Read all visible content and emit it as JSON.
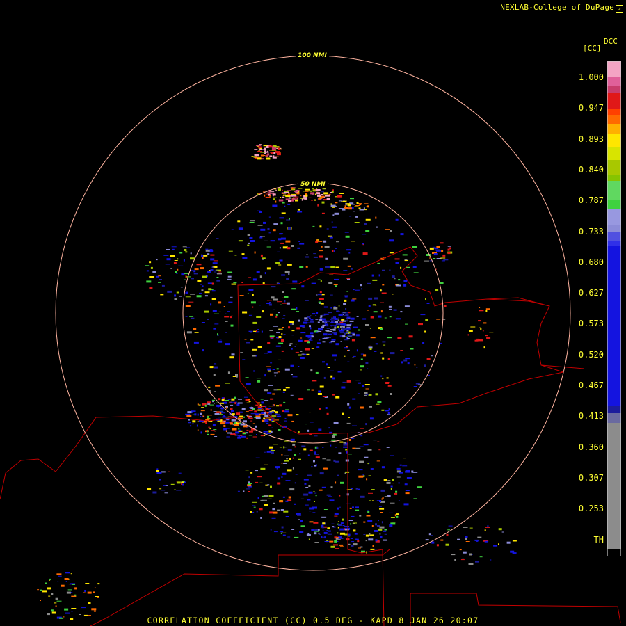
{
  "header": {
    "credit": "NEXLAB-College of DuPage",
    "credit_icon": "external-link-icon"
  },
  "footer": {
    "caption": "CORRELATION COEFFICIENT (CC) 0.5 DEG - KAPD 8 JAN 26 20:07"
  },
  "rings": [
    {
      "label": "100 NMI",
      "range_nmi": 100
    },
    {
      "label": "50 NMI",
      "range_nmi": 50
    }
  ],
  "legend": {
    "title": "DCC",
    "unit": "[CC]",
    "labels": [
      "1.000",
      "0.947",
      "0.893",
      "0.840",
      "0.787",
      "0.733",
      "0.680",
      "0.627",
      "0.573",
      "0.520",
      "0.467",
      "0.413",
      "0.360",
      "0.307",
      "0.253",
      "TH"
    ],
    "colors": {
      "pink": "#f4a4c4",
      "magenta": "#c83c6c",
      "red": "#e01818",
      "orange": "#ff6a00",
      "yellow": "#ffe600",
      "olive": "#a8c800",
      "green": "#3fd23f",
      "lavender": "#8c8cd8",
      "blue": "#1414e0",
      "navy": "#1c1c9c",
      "gray": "#8c8c8c",
      "black": "#000000"
    }
  },
  "map": {
    "ring_color": "#ffb4a0",
    "border_color": "#c00000",
    "background": "#000000"
  }
}
